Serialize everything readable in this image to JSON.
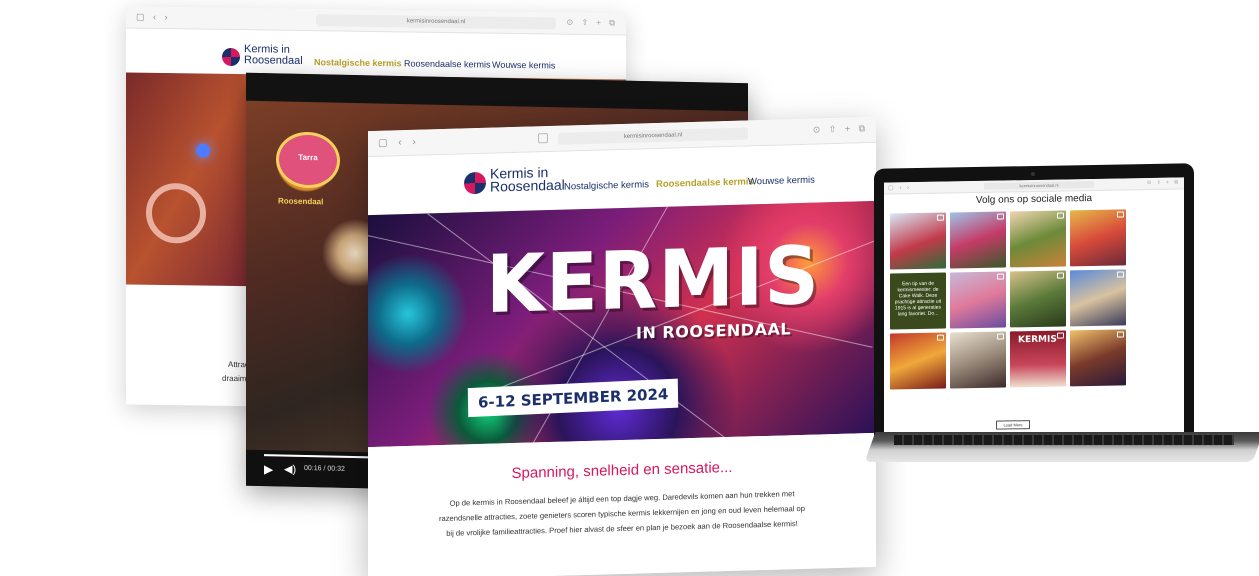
{
  "site": {
    "logo_line1": "Kermis in",
    "logo_line2": "Roosendaal",
    "nav": [
      "Nostalgische kermis",
      "Roosendaalse kermis",
      "Wouwse kermis"
    ],
    "url": "kermisinroosendaal.nl"
  },
  "back_window": {
    "caption_line1": "Attrac",
    "caption_line2": "draaim"
  },
  "video_window": {
    "poster_line1": "Tarra",
    "poster_line2": "Roosendaal",
    "time": "00:16 / 00:32",
    "progress": 0.5
  },
  "front_window": {
    "hero_title": "KERMIS",
    "hero_subtitle": "IN ROOSENDAAL",
    "hero_date": "6-12 SEPTEMBER 2024",
    "heading": "Spanning, snelheid en sensatie...",
    "paragraph": "Op de kermis in Roosendaal beleef je áltijd een top dagje weg. Daredevils komen aan hun trekken met razendsnelle attracties, zoete genieters scoren typische kermis lekkernijen en jong en oud leven helemaal op bij de vrolijke familieattracties. Proef hier alvast de sfeer en plan je bezoek aan de Roosendaalse kermis!"
  },
  "laptop": {
    "title": "Volg ons op sociale media",
    "text_tile": "Een tip van de kermismeester: de Cake Walk. Deze prachtige attractie uit 1915 is al generaties lang favoriet. Do...",
    "kermis_tile": "KERMIS",
    "button": "Load More"
  },
  "colors": {
    "brand_pink": "#d6185e",
    "brand_navy": "#1b2f6b",
    "brand_gold": "#b8a12a"
  }
}
